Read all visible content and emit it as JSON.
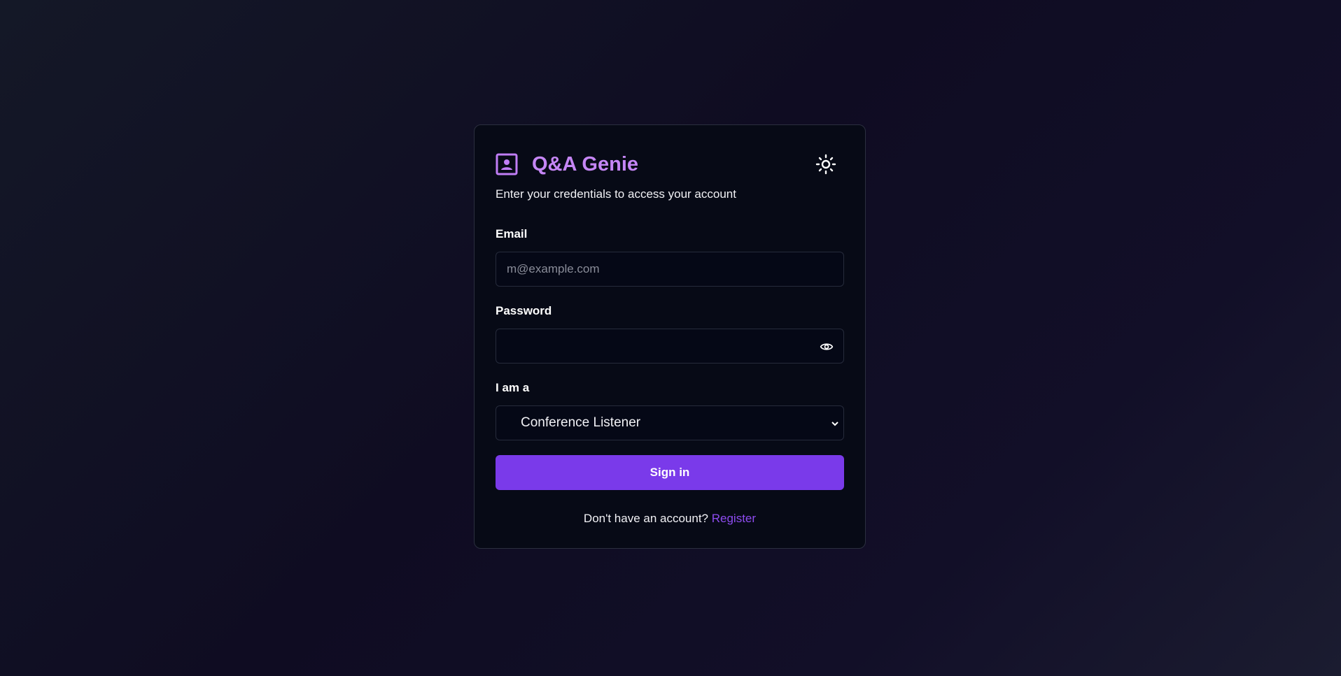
{
  "app": {
    "title": "Q&A Genie",
    "subtitle": "Enter your credentials to access your account"
  },
  "form": {
    "email_label": "Email",
    "email_placeholder": "m@example.com",
    "email_value": "",
    "password_label": "Password",
    "password_value": "",
    "role_label": "I am a",
    "role_selected": "Conference Listener",
    "submit_label": "Sign in"
  },
  "footer": {
    "prompt": "Don't have an account?",
    "link": "Register"
  },
  "colors": {
    "accent": "#7a3aea",
    "title": "#c586f5",
    "link": "#8e4cf0"
  }
}
